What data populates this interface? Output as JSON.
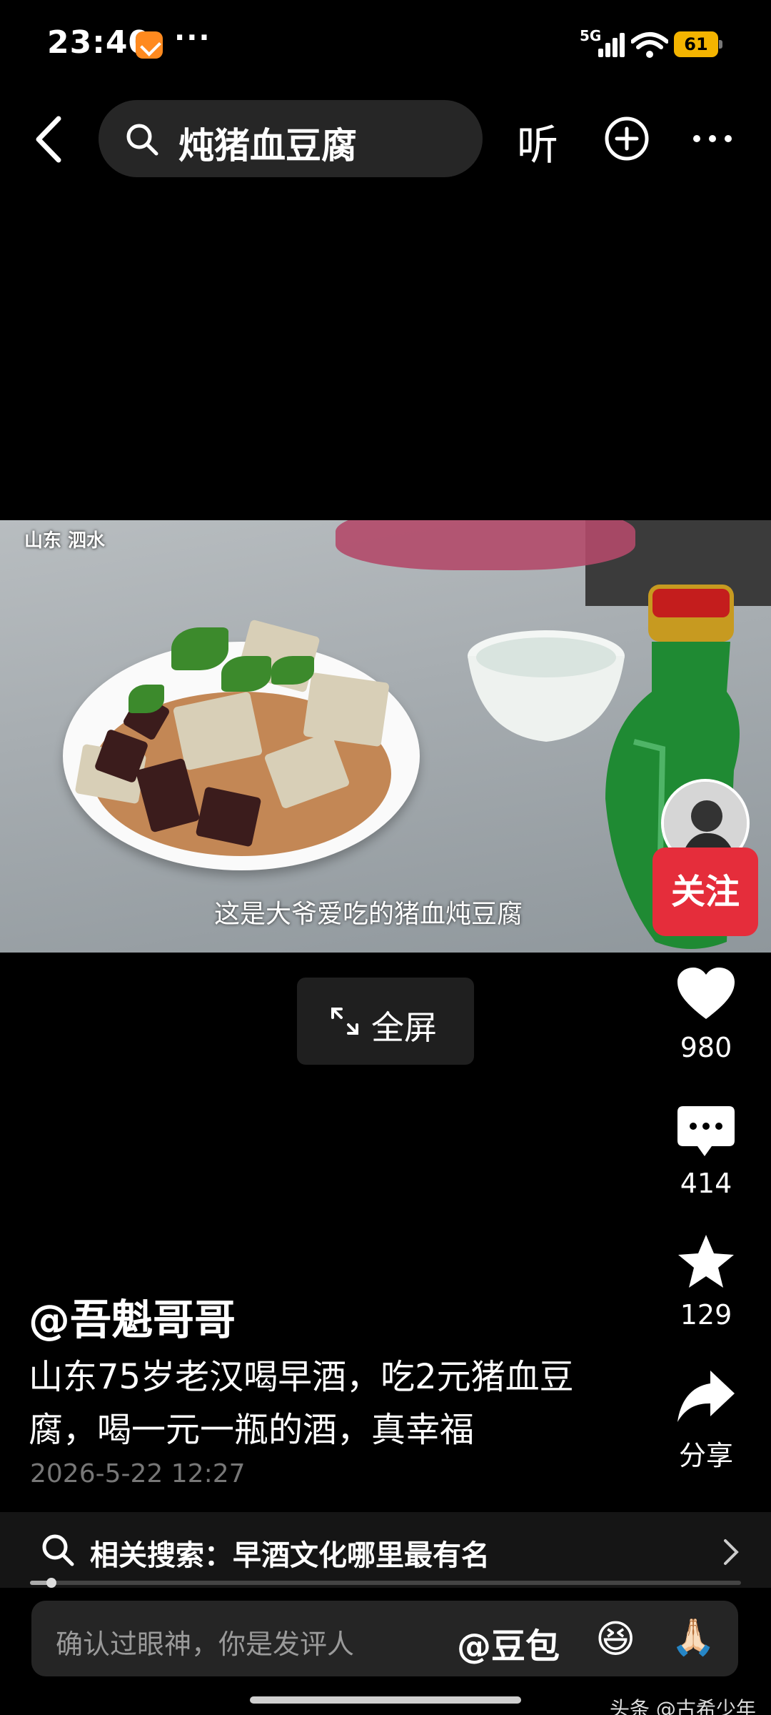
{
  "status": {
    "time": "23:40",
    "network": "5G",
    "battery": "61"
  },
  "header": {
    "search_query": "炖猪血豆腐",
    "listen_label": "听"
  },
  "video": {
    "location_label": "山东 泗水",
    "subtitle": "这是大爷爱吃的猪血炖豆腐",
    "fullscreen_label": "全屏",
    "progress": 0.03
  },
  "rail": {
    "follow_label": "关注",
    "like_count": "980",
    "comment_count": "414",
    "favorite_count": "129",
    "share_label": "分享"
  },
  "post": {
    "author": "@吾魁哥哥",
    "description": "山东75岁老汉喝早酒，吃2元猪血豆腐，喝一元一瓶的酒，真幸福",
    "date": "2026-5-22 12:27"
  },
  "related": {
    "text": "相关搜索：早酒文化哪里最有名"
  },
  "comment_bar": {
    "placeholder": "确认过眼神，你是发评人",
    "mention": "@豆包",
    "emoji1": "😆",
    "emoji2": "🙏🏻"
  },
  "watermark": "头条 @古希少年",
  "colors": {
    "follow_red": "#e52d3b",
    "battery_yellow": "#f4b400"
  }
}
